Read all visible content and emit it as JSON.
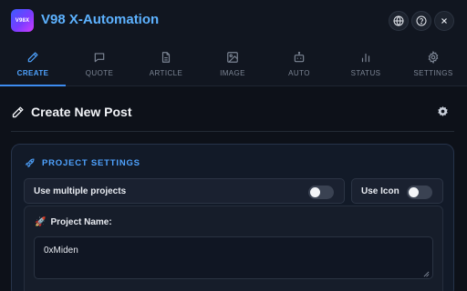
{
  "app": {
    "title": "V98 X-Automation",
    "logo_text": "V98X"
  },
  "header_buttons": [
    {
      "icon": "globe-icon"
    },
    {
      "icon": "help-icon"
    },
    {
      "icon": "close-icon"
    }
  ],
  "tabs": [
    {
      "label": "CREATE",
      "icon": "pencil-icon",
      "active": true
    },
    {
      "label": "QUOTE",
      "icon": "quote-icon"
    },
    {
      "label": "ARTICLE",
      "icon": "document-icon"
    },
    {
      "label": "IMAGE",
      "icon": "image-icon"
    },
    {
      "label": "AUTO",
      "icon": "robot-icon"
    },
    {
      "label": "STATUS",
      "icon": "bar-chart-icon"
    },
    {
      "label": "SETTINGS",
      "icon": "gear-icon"
    }
  ],
  "main": {
    "title": "Create New Post",
    "title_icon": "pencil-icon",
    "settings_icon": "gear-icon"
  },
  "project_settings": {
    "heading": "PROJECT SETTINGS",
    "heading_icon": "rocket-icon",
    "use_multiple_projects": {
      "label": "Use multiple projects",
      "enabled": false
    },
    "use_icon": {
      "label": "Use Icon",
      "enabled": false
    },
    "project_name": {
      "label": "Project Name:",
      "emoji": "🚀",
      "value": "0xMiden"
    }
  },
  "colors": {
    "background": "#0d1119",
    "accent": "#4fa3ff",
    "title_blue": "#5db2ff",
    "card_border": "#26334a"
  }
}
